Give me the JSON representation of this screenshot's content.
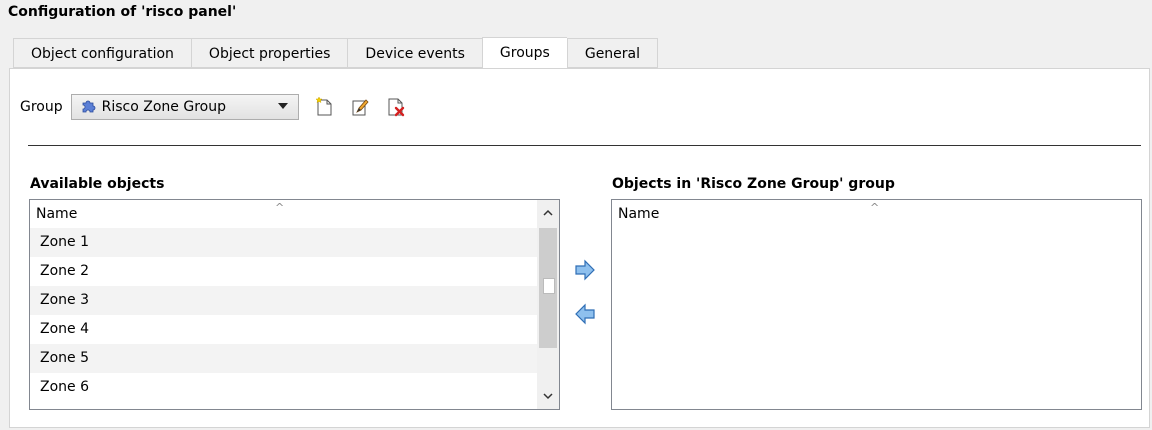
{
  "window": {
    "title": "Configuration of 'risco panel'"
  },
  "tabs": [
    {
      "label": "Object configuration"
    },
    {
      "label": "Object properties"
    },
    {
      "label": "Device events"
    },
    {
      "label": "Groups"
    },
    {
      "label": "General"
    }
  ],
  "active_tab": "Groups",
  "group": {
    "label": "Group",
    "selected": "Risco Zone Group",
    "icon": "group-puzzle-icon",
    "actions": [
      {
        "name": "new-group",
        "icon": "new-document-icon"
      },
      {
        "name": "edit-group",
        "icon": "edit-pencil-icon"
      },
      {
        "name": "delete-group",
        "icon": "delete-document-icon"
      }
    ]
  },
  "available": {
    "heading": "Available objects",
    "column": "Name",
    "items": [
      "Zone 1",
      "Zone 2",
      "Zone 3",
      "Zone 4",
      "Zone 5",
      "Zone 6"
    ]
  },
  "in_group": {
    "heading": "Objects in 'Risco Zone Group' group",
    "column": "Name",
    "items": []
  },
  "colors": {
    "arrow_fill": "#6fa8dc",
    "arrow_stroke": "#2f6eb5",
    "delete_red": "#d42020"
  }
}
